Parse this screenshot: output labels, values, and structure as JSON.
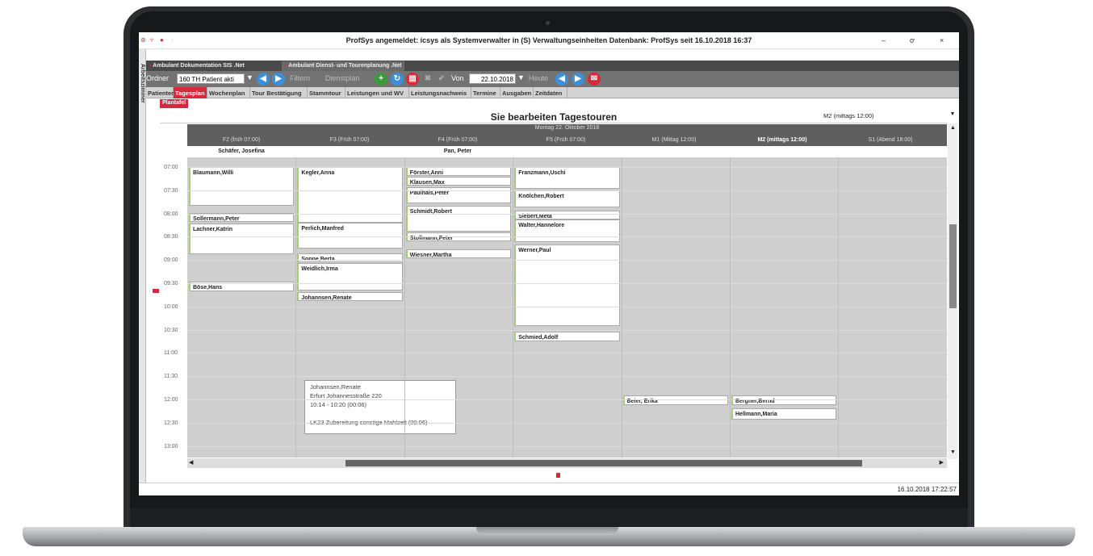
{
  "window": {
    "title": "ProfSys angemeldet: icsys als Systemverwalter in (S) Verwaltungseinheiten Datenbank: ProfSys seit 16.10.2018 16:37",
    "minimize": "–",
    "maximize": "ơ",
    "close": "×"
  },
  "sidebar": {
    "label": "Arbeitszimmer"
  },
  "doc_tabs": [
    {
      "label": "Ambulant Dokumentation SIS .Net"
    },
    {
      "label": "Ambulant Dienst- und Tourenplanung .Net"
    }
  ],
  "toolbar": {
    "ordner_label": "Ordner",
    "ordner_value": "160 TH Patient akti",
    "filtern": "Filtern",
    "dienstplan": "Dienstplan",
    "von_label": "Von",
    "von_value": "22.10.2018",
    "heute": "Heute"
  },
  "nav_tabs": [
    {
      "label": "Patienten"
    },
    {
      "label": "Tagesplan"
    },
    {
      "label": "Wochenplan"
    },
    {
      "label": "Tour Bestätigung"
    },
    {
      "label": "Stammtour"
    },
    {
      "label": "Leistungen und WV"
    },
    {
      "label": "Leistungsnachweis"
    },
    {
      "label": "Termine"
    },
    {
      "label": "Ausgaben"
    },
    {
      "label": "Zeitdaten"
    }
  ],
  "plantafel": "Plantafel",
  "header": {
    "title": "Sie bearbeiten Tagestouren",
    "tour_select": "M2 (mittags 12:00)",
    "date": "Montag 22. Oktober 2018"
  },
  "columns": [
    {
      "label": "F2 (früh 07:00)",
      "pinned": "Schäfer, Josefina"
    },
    {
      "label": "F3 (Früh 07:00)",
      "pinned": ""
    },
    {
      "label": "F4 (Früh 07:00)",
      "pinned": "Pan, Peter"
    },
    {
      "label": "F5 (Früh 07:00)",
      "pinned": ""
    },
    {
      "label": "M1 (Mittag 12:00)",
      "pinned": ""
    },
    {
      "label": "M2 (mittags 12:00)",
      "pinned": ""
    },
    {
      "label": "S1 (Abend 18:00)",
      "pinned": ""
    }
  ],
  "times": [
    "07:00",
    "07:30",
    "08:00",
    "08:30",
    "09:00",
    "09:30",
    "10:00",
    "10:30",
    "11:00",
    "11:30",
    "12:00",
    "12:30",
    "13:00"
  ],
  "appointments": [
    {
      "col": 0,
      "name": "Blaumann,Willi",
      "start": "07:00",
      "end": "07:50"
    },
    {
      "col": 0,
      "name": "Sollermann,Peter",
      "start": "07:59",
      "end": "08:10"
    },
    {
      "col": 0,
      "name": "Lachner,Katrin",
      "start": "08:13",
      "end": "08:53"
    },
    {
      "col": 0,
      "name": "Böse,Hans",
      "start": "09:28",
      "end": "09:40"
    },
    {
      "col": 1,
      "name": "Kegler,Anna",
      "start": "07:00",
      "end": "08:12"
    },
    {
      "col": 1,
      "name": "Perlich,Manfred",
      "start": "08:12",
      "end": "08:45"
    },
    {
      "col": 1,
      "name": "Sonne,Berta",
      "start": "08:51",
      "end": "09:02"
    },
    {
      "col": 1,
      "name": "Weidlich,Irma",
      "start": "09:04",
      "end": "09:39"
    },
    {
      "col": 1,
      "name": "Johannsen,Renate",
      "start": "09:41",
      "end": "09:52"
    },
    {
      "col": 2,
      "name": "Förster,Anni",
      "start": "07:00",
      "end": "07:11"
    },
    {
      "col": 2,
      "name": "Klausen,Max",
      "start": "07:13",
      "end": "07:24"
    },
    {
      "col": 2,
      "name": "Paulhals,Peter",
      "start": "07:26",
      "end": "07:47"
    },
    {
      "col": 2,
      "name": "Schmidt,Robert",
      "start": "07:50",
      "end": "08:23"
    },
    {
      "col": 2,
      "name": "Stollmann,Peter",
      "start": "08:24",
      "end": "08:36"
    },
    {
      "col": 2,
      "name": "Wiesner,Martha",
      "start": "08:46",
      "end": "08:58"
    },
    {
      "col": 3,
      "name": "Franzmann,Uschi",
      "start": "07:00",
      "end": "07:28"
    },
    {
      "col": 3,
      "name": "Knölchen,Robert",
      "start": "07:30",
      "end": "07:52"
    },
    {
      "col": 3,
      "name": "Siebert,Meta",
      "start": "07:56",
      "end": "08:06"
    },
    {
      "col": 3,
      "name": "Walter,Hannelore",
      "start": "08:08",
      "end": "08:37"
    },
    {
      "col": 3,
      "name": "Werner,Paul",
      "start": "08:40",
      "end": "10:25"
    },
    {
      "col": 3,
      "name": "Schmied,Adolf",
      "start": "10:33",
      "end": "10:45"
    },
    {
      "col": 4,
      "name": "Beier, Erika",
      "start": "11:55",
      "end": "12:07"
    },
    {
      "col": 5,
      "name": "Bergner,Bernd",
      "start": "11:55",
      "end": "12:07"
    },
    {
      "col": 5,
      "name": "Hellmann,Maria",
      "start": "12:11",
      "end": "12:26"
    }
  ],
  "tooltip": {
    "name": "Johannsen,Renate",
    "address": "Erfurt Johannesstraße 220",
    "time": "10:14 - 10:20 (00:06)",
    "service": "LK23 Zubereitung sonstige Mahlzeit (00:06)"
  },
  "status_time": "16.10.2018 17:22:57",
  "colors": {
    "accent": "#d8283b",
    "toolbar": "#737373",
    "grid": "#cfcfcf"
  }
}
